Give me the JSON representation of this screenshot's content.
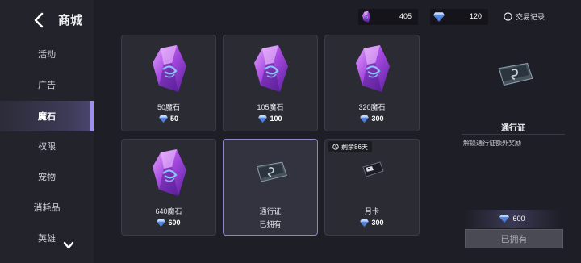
{
  "header": {
    "title": "商城"
  },
  "sidebar": {
    "items": [
      {
        "label": "活动"
      },
      {
        "label": "广告"
      },
      {
        "label": "魔石"
      },
      {
        "label": "权限"
      },
      {
        "label": "宠物"
      },
      {
        "label": "消耗品"
      },
      {
        "label": "英雄"
      }
    ]
  },
  "topbar": {
    "magic_stone": "405",
    "diamond": "120",
    "records": "交易记录"
  },
  "cards": [
    {
      "name": "50魔石",
      "price": "50"
    },
    {
      "name": "105魔石",
      "price": "100"
    },
    {
      "name": "320魔石",
      "price": "300"
    },
    {
      "name": "640魔石",
      "price": "600"
    },
    {
      "name": "通行证",
      "status": "已拥有"
    },
    {
      "name": "月卡",
      "price": "300",
      "timer": "剩余86天"
    }
  ],
  "detail": {
    "title": "通行证",
    "description": "解锁通行证额外奖励",
    "price": "600",
    "button": "已拥有"
  },
  "colors": {
    "accent": "#9d8ff0",
    "diamond": "#7fb0ff",
    "magic_stone": "#b65ee8"
  }
}
